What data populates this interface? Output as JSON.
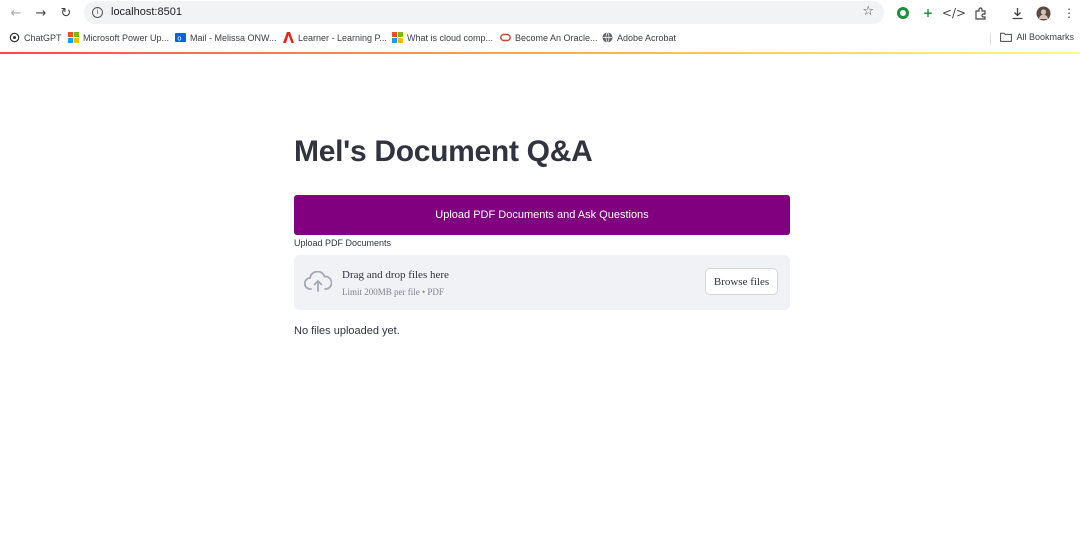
{
  "browser": {
    "url": "localhost:8501",
    "bookmarks": [
      {
        "label": "ChatGPT",
        "icon": "chatgpt-icon"
      },
      {
        "label": "Microsoft Power Up...",
        "icon": "microsoft-icon"
      },
      {
        "label": "Mail - Melissa ONW...",
        "icon": "outlook-icon"
      },
      {
        "label": "Learner - Learning P...",
        "icon": "adobe-icon"
      },
      {
        "label": "What is cloud comp...",
        "icon": "microsoft-icon"
      },
      {
        "label": "Become An Oracle...",
        "icon": "oracle-icon"
      },
      {
        "label": "Adobe Acrobat",
        "icon": "globe-icon"
      }
    ],
    "all_bookmarks": "All Bookmarks"
  },
  "app": {
    "title": "Mel's Document Q&A",
    "banner": "Upload PDF Documents and Ask Questions",
    "uploader": {
      "label": "Upload PDF Documents",
      "drop_text": "Drag and drop files here",
      "limit_text": "Limit 200MB per file • PDF",
      "browse_label": "Browse files"
    },
    "status": "No files uploaded yet."
  },
  "colors": {
    "banner_bg": "#800080",
    "title_text": "#31333f",
    "dropzone_bg": "#f0f2f6"
  }
}
